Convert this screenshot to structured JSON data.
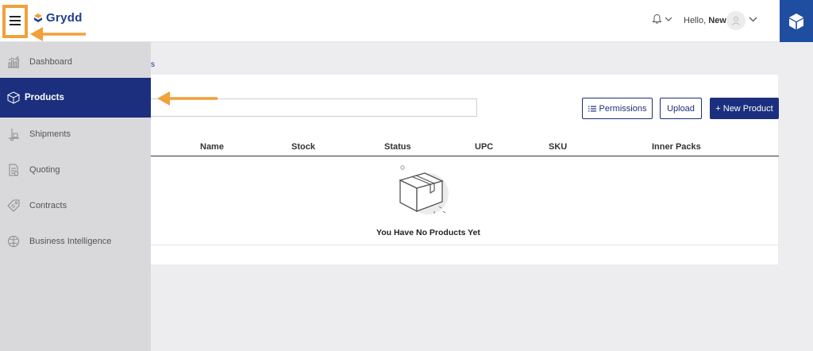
{
  "header": {
    "brand": "Grydd",
    "greeting_prefix": "Hello, ",
    "greeting_name": "New"
  },
  "sidebar": {
    "items": [
      {
        "label": "Dashboard",
        "icon": "bar-chart-icon",
        "active": false
      },
      {
        "label": "Products",
        "icon": "cube-icon",
        "active": true
      },
      {
        "label": "Shipments",
        "icon": "dolly-icon",
        "active": false
      },
      {
        "label": "Quoting",
        "icon": "document-icon",
        "active": false
      },
      {
        "label": "Contracts",
        "icon": "tag-icon",
        "active": false
      },
      {
        "label": "Business Intelligence",
        "icon": "brain-icon",
        "active": false
      }
    ]
  },
  "breadcrumb": {
    "visible_fragment": "s"
  },
  "toolbar": {
    "permissions_label": "Permissions",
    "upload_label": "Upload",
    "new_product_label": "+ New Product"
  },
  "table": {
    "columns": [
      "Name",
      "Stock",
      "Status",
      "UPC",
      "SKU",
      "Inner Packs"
    ]
  },
  "empty_state": {
    "message": "You Have No Products Yet"
  },
  "colors": {
    "primary": "#1b2f7e",
    "accent_annotation": "#f0a13a",
    "sidebar_bg": "#d9d9db",
    "brand_blue": "#1f4ea0"
  }
}
